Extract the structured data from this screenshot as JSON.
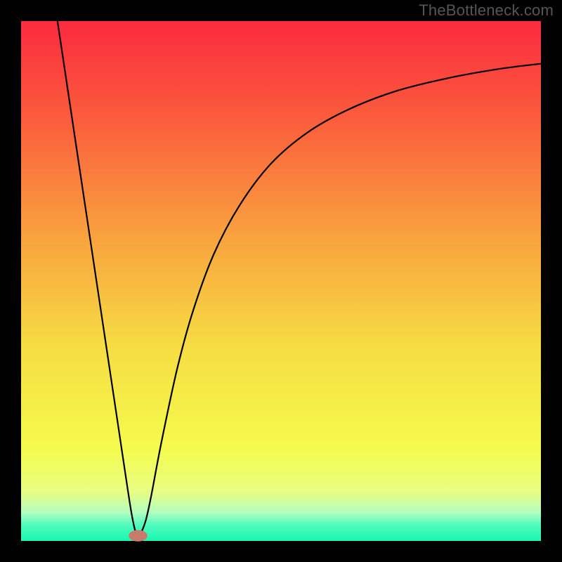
{
  "watermark": "TheBottleneck.com",
  "chart_data": {
    "type": "line",
    "title": "",
    "xlabel": "",
    "ylabel": "",
    "xlim": [
      0,
      100
    ],
    "ylim": [
      0,
      100
    ],
    "background_gradient": {
      "stops": [
        {
          "offset": 0.0,
          "color": "#fb2b3e"
        },
        {
          "offset": 0.18,
          "color": "#fb5a3c"
        },
        {
          "offset": 0.4,
          "color": "#f99e3e"
        },
        {
          "offset": 0.62,
          "color": "#f6db43"
        },
        {
          "offset": 0.82,
          "color": "#f5fb4c"
        },
        {
          "offset": 0.905,
          "color": "#e9fd82"
        },
        {
          "offset": 0.945,
          "color": "#b2fec0"
        },
        {
          "offset": 0.97,
          "color": "#4efbbd"
        },
        {
          "offset": 1.0,
          "color": "#19f7b1"
        }
      ]
    },
    "frame": {
      "outer": 800,
      "inner_x": 30,
      "inner_y": 30,
      "inner_w": 740,
      "inner_h": 740
    },
    "marker": {
      "x": 22.5,
      "y": 1.0,
      "rx": 1.8,
      "ry": 1.1,
      "fill": "#c87a6b"
    },
    "series": [
      {
        "name": "curve",
        "type": "line",
        "points": [
          {
            "x": 7.0,
            "y": 100.0
          },
          {
            "x": 8.5,
            "y": 90.0
          },
          {
            "x": 10.0,
            "y": 80.0
          },
          {
            "x": 11.5,
            "y": 70.0
          },
          {
            "x": 13.0,
            "y": 60.0
          },
          {
            "x": 14.5,
            "y": 50.0
          },
          {
            "x": 16.0,
            "y": 40.0
          },
          {
            "x": 17.5,
            "y": 30.0
          },
          {
            "x": 19.0,
            "y": 20.0
          },
          {
            "x": 20.5,
            "y": 10.0
          },
          {
            "x": 21.3,
            "y": 5.0
          },
          {
            "x": 22.0,
            "y": 1.8
          },
          {
            "x": 22.5,
            "y": 1.0
          },
          {
            "x": 23.0,
            "y": 1.4
          },
          {
            "x": 24.0,
            "y": 4.0
          },
          {
            "x": 25.0,
            "y": 8.5
          },
          {
            "x": 27.0,
            "y": 19.0
          },
          {
            "x": 30.0,
            "y": 33.0
          },
          {
            "x": 33.0,
            "y": 44.0
          },
          {
            "x": 37.0,
            "y": 55.0
          },
          {
            "x": 42.0,
            "y": 64.5
          },
          {
            "x": 48.0,
            "y": 72.5
          },
          {
            "x": 55.0,
            "y": 78.5
          },
          {
            "x": 63.0,
            "y": 83.0
          },
          {
            "x": 72.0,
            "y": 86.5
          },
          {
            "x": 82.0,
            "y": 89.0
          },
          {
            "x": 92.0,
            "y": 90.8
          },
          {
            "x": 100.0,
            "y": 91.8
          }
        ]
      }
    ]
  }
}
